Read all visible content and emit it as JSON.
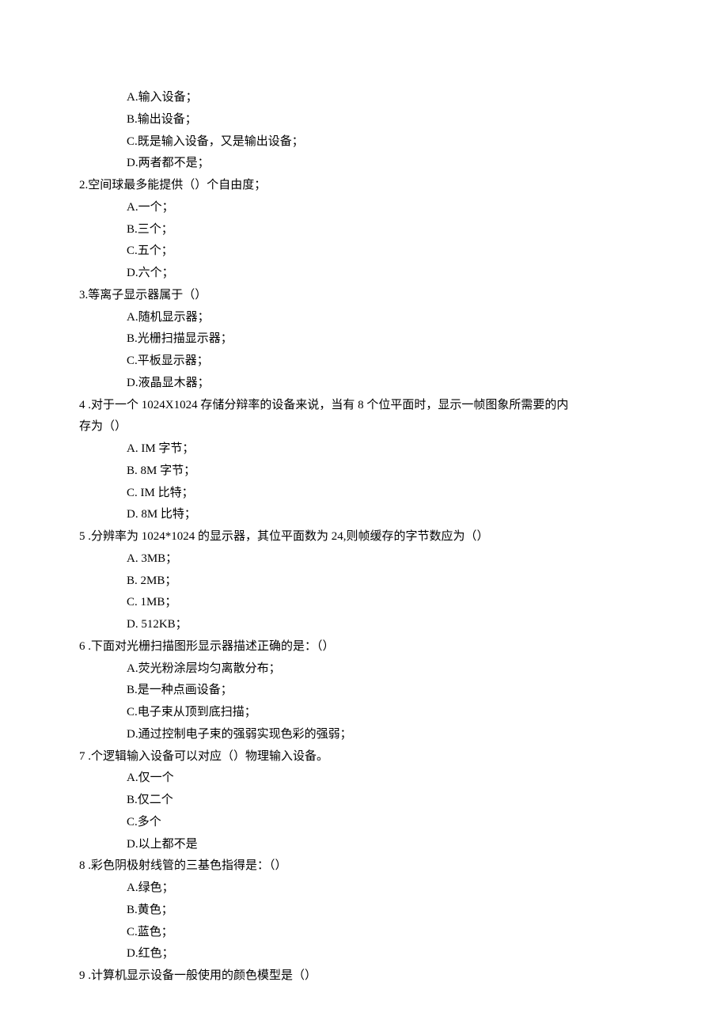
{
  "q1": {
    "optA": "A.输入设备；",
    "optB": "B.输出设备；",
    "optC": "C.既是输入设备，又是输出设备；",
    "optD": "D.两者都不是；"
  },
  "q2": {
    "stem": "2.空间球最多能提供（）个自由度；",
    "optA": "A.一个；",
    "optB": "B.三个；",
    "optC": "C.五个；",
    "optD": "D.六个；"
  },
  "q3": {
    "stem": "3.等离子显示器属于（）",
    "optA": "A.随机显示器；",
    "optB": "B.光栅扫描显示器；",
    "optC": "C.平板显示器；",
    "optD": "D.液晶显木器；"
  },
  "q4": {
    "stem": "4  .对于一个 1024X1024 存储分辩率的设备来说，当有 8 个位平面时，显示一帧图象所需要的内",
    "stem2": "存为（）",
    "optA": "A.   IM 字节；",
    "optB": "B.   8M 字节；",
    "optC": "C.   IM 比特；",
    "optD": "D.   8M 比特；"
  },
  "q5": {
    "stem": "5  .分辨率为 1024*1024 的显示器，其位平面数为 24,则帧缓存的字节数应为（）",
    "optA": "A.   3MB；",
    "optB": "B.   2MB；",
    "optC": "C.   1MB；",
    "optD": "D.   512KB；"
  },
  "q6": {
    "stem": "6  .下面对光栅扫描图形显示器描述正确的是：（）",
    "optA": "A.荧光粉涂层均匀离散分布；",
    "optB": "B.是一种点画设备；",
    "optC": "C.电子束从顶到底扫描；",
    "optD": "D.通过控制电子束的强弱实现色彩的强弱；"
  },
  "q7": {
    "stem": "7  .个逻辑输入设备可以对应（）物理输入设备。",
    "optA": "A.仅一个",
    "optB": "B.仅二个",
    "optC": "C.多个",
    "optD": "D.以上都不是"
  },
  "q8": {
    "stem": "8  .彩色阴极射线管的三基色指得是：（）",
    "optA": "A.绿色；",
    "optB": "B.黄色；",
    "optC": "C.蓝色；",
    "optD": "D.红色；"
  },
  "q9": {
    "stem": "9  .计算机显示设备一般使用的颜色模型是（）"
  }
}
